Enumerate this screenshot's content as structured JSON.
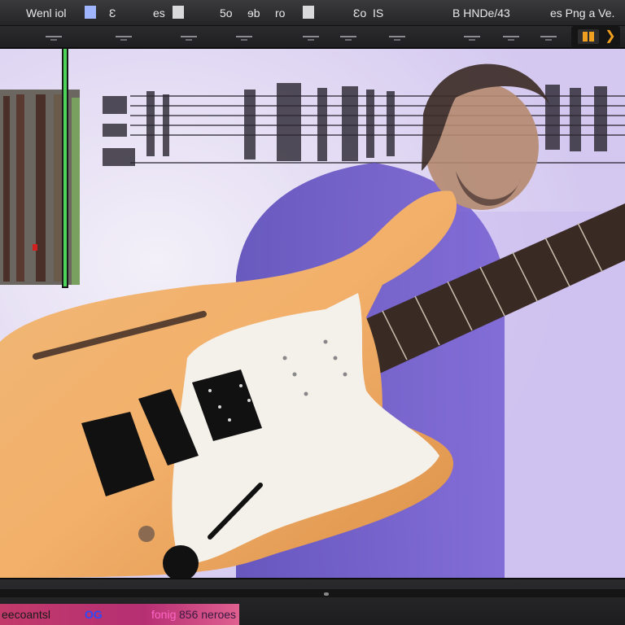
{
  "menu": {
    "item1": "Wenl iol",
    "item2": "Ɛ",
    "item3": "es",
    "item4": "5o",
    "item5": "ɘb",
    "item6": "ro",
    "item7": "Ɛo",
    "item8": "IS",
    "title": "B HNDe/43",
    "right": "es Png a Ve."
  },
  "status": {
    "s1": "eecoantsl",
    "s2": "OG",
    "s3": "fonig",
    "s4": "856  neroes"
  },
  "colors": {
    "accent": "#f0a020",
    "meter": "#4cd35a",
    "status_bg": "#c23a6a"
  },
  "icons": {
    "pause": "pause-icon",
    "next": "skip-forward-icon"
  }
}
